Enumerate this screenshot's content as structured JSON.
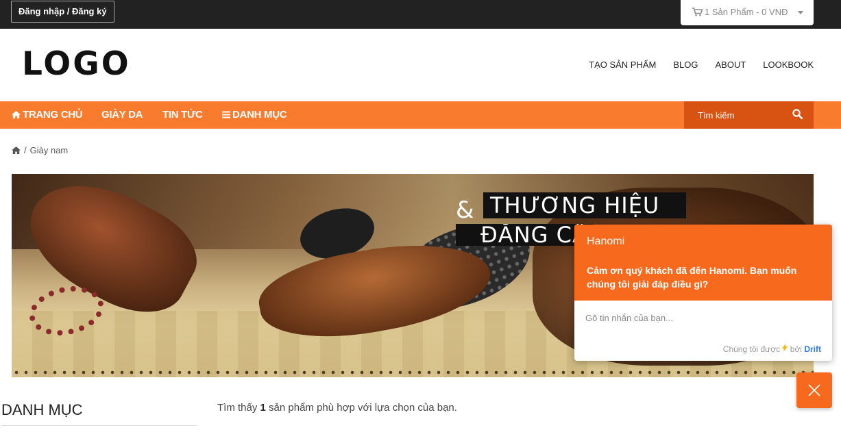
{
  "topbar": {
    "login_label": "Đăng nhập / Đăng ký",
    "cart_label": "1 Sản Phẩm - 0 VNĐ"
  },
  "header": {
    "logo": "LOGO",
    "nav": [
      "TẠO SẢN PHẨM",
      "BLOG",
      "ABOUT",
      "LOOKBOOK"
    ]
  },
  "main_nav": {
    "items": [
      "TRANG CHỦ",
      "GIÀY DA",
      "TIN TỨC",
      "DANH MỤC"
    ],
    "search_placeholder": "Tìm kiếm"
  },
  "breadcrumb": {
    "separator": "/",
    "current": "Giày nam"
  },
  "banner": {
    "amp": "&",
    "line1": "THƯƠNG HIỆU",
    "line2": "ĐẲNG CẤ"
  },
  "sidebar": {
    "title": "DANH MỤC"
  },
  "results": {
    "prefix": "Tìm thấy",
    "count": "1",
    "suffix": "sản phẩm phù hợp với lựa chọn của bạn."
  },
  "chat": {
    "name": "Hanomi",
    "message": "Cảm ơn quý khách đã đến Hanomi. Bạn muốn chúng tôi giải đáp điều gì?",
    "input_placeholder": "Gõ tin nhắn của bạn...",
    "footer_prefix": "Chúng tôi được",
    "footer_by": "bởi",
    "footer_brand": "Drift"
  },
  "colors": {
    "nav_orange": "#f97b2e",
    "search_dark_orange": "#d85212",
    "chat_orange": "#f76a1e",
    "topbar_dark": "#222222",
    "drift_blue": "#2b7de9"
  }
}
